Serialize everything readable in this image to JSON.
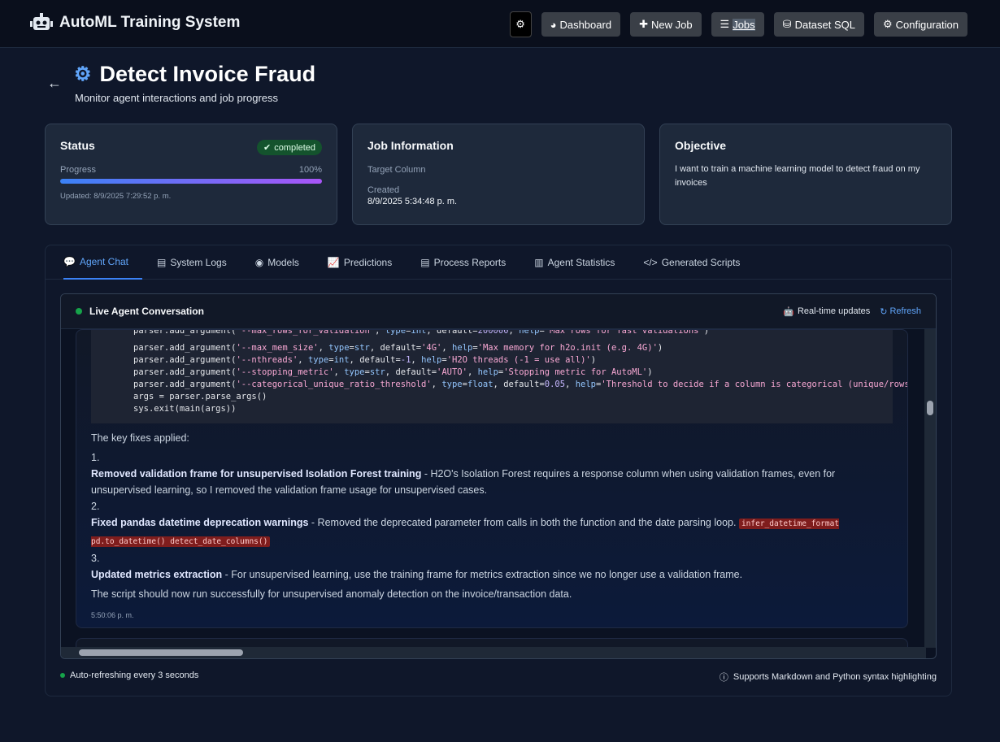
{
  "nav": {
    "brand": "AutoML Training System",
    "items": [
      "Dashboard",
      "New Job",
      "Jobs",
      "Dataset SQL",
      "Configuration"
    ]
  },
  "page": {
    "back": "←",
    "title": "Detect Invoice Fraud",
    "subtitle": "Monitor agent interactions and job progress"
  },
  "status": {
    "title": "Status",
    "badge": "completed",
    "progress_label": "Progress",
    "progress_value": "100%",
    "progress": 1.0,
    "updated": "Updated: 8/9/2025 7:29:52 p. m."
  },
  "jobinfo": {
    "title": "Job Information",
    "target_label": "Target Column",
    "created_label": "Created",
    "created": "8/9/2025 5:34:48 p. m."
  },
  "objective": {
    "title": "Objective",
    "text": "I want to train a machine learning model to detect fraud on my invoices"
  },
  "tabs": [
    "Agent Chat",
    "System Logs",
    "Models",
    "Predictions",
    "Process Reports",
    "Agent Statistics",
    "Generated Scripts"
  ],
  "chat": {
    "title": "Live Agent Conversation",
    "realtime": "Real-time updates",
    "refresh": "Refresh",
    "intro": "The key fixes applied:",
    "fix1_num": "1.",
    "fix1_title": "Removed validation frame for unsupervised Isolation Forest training",
    "fix1_text": " - H2O's Isolation Forest requires a response column when using validation frames, even for unsupervised learning, so I removed the validation frame usage for unsupervised cases.",
    "fix2_num": "2.",
    "fix2_title": "Fixed pandas datetime deprecation warnings",
    "fix2_text": " - Removed the deprecated parameter from calls in both the function and the date parsing loop.",
    "fix2_code": "infer_datetime_format pd.to_datetime() detect_date_columns()",
    "fix3_num": "3.",
    "fix3_title": "Updated metrics extraction",
    "fix3_text": " - For unsupervised learning, use the training frame for metrics extraction since we no longer use a validation frame.",
    "closing": "The script should now run successfully for unsupervised anomaly detection on the invoice/transaction data.",
    "time": "5:50:06 p. m."
  },
  "footer": {
    "left": "Auto-refreshing every 3 seconds",
    "right": "Supports Markdown and Python syntax highlighting"
  }
}
